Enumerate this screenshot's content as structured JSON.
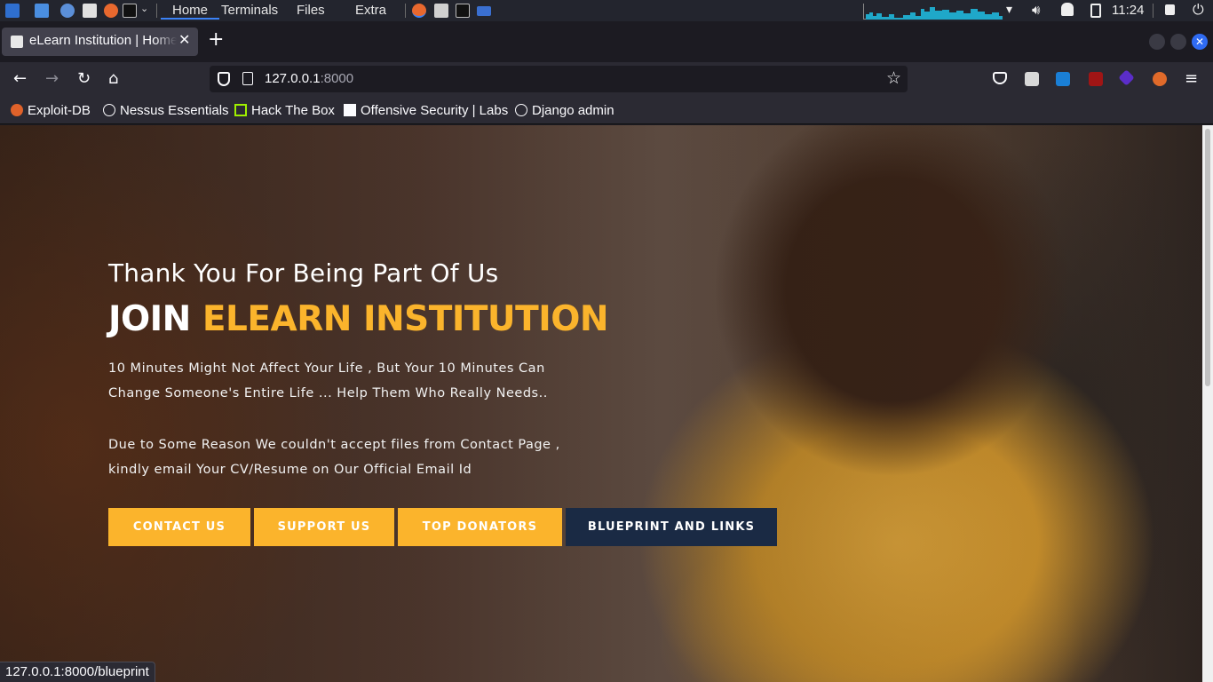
{
  "taskbar": {
    "workspaces": [
      "Home",
      "Terminals",
      "Files",
      "Extra"
    ],
    "clock": "11:24"
  },
  "browser": {
    "tab_title": "eLearn Institution | Home",
    "tab_close": "✕",
    "new_tab": "+",
    "url_host": "127.0.0.1",
    "url_port": ":8000",
    "bookmarks": [
      "Exploit-DB",
      "Nessus Essentials",
      "Hack The Box",
      "Offensive Security | Labs",
      "Django admin"
    ],
    "status_url": "127.0.0.1:8000/blueprint"
  },
  "hero": {
    "tagline": "Thank You For Being Part Of Us",
    "headline_prefix": "JOIN ",
    "headline_accent": "ELEARN INSTITUTION",
    "paragraph1": "10 Minutes Might Not Affect Your Life , But Your 10 Minutes Can Change Someone's Entire Life ... Help Them Who Really Needs..",
    "paragraph2": "Due to Some Reason We couldn't accept files from Contact Page , kindly email Your CV/Resume on Our Official Email Id",
    "buttons": [
      "CONTACT US",
      "SUPPORT US",
      "TOP DONATORS",
      "BLUEPRINT AND LINKS"
    ]
  },
  "colors": {
    "accent": "#fbb42c",
    "dark_button": "#1a2a44",
    "browser_bg": "#1c1b22",
    "toolbar_bg": "#2b2a33"
  },
  "icons": {
    "taskbar": [
      "kali-menu-icon",
      "file-manager-icon",
      "chromium-icon",
      "text-editor-icon",
      "firefox-icon",
      "terminal-icon"
    ],
    "nav": [
      "back-icon",
      "forward-icon",
      "reload-icon",
      "home-icon",
      "shield-icon",
      "page-icon",
      "bookmark-star-icon",
      "pocket-icon",
      "menu-icon"
    ]
  }
}
